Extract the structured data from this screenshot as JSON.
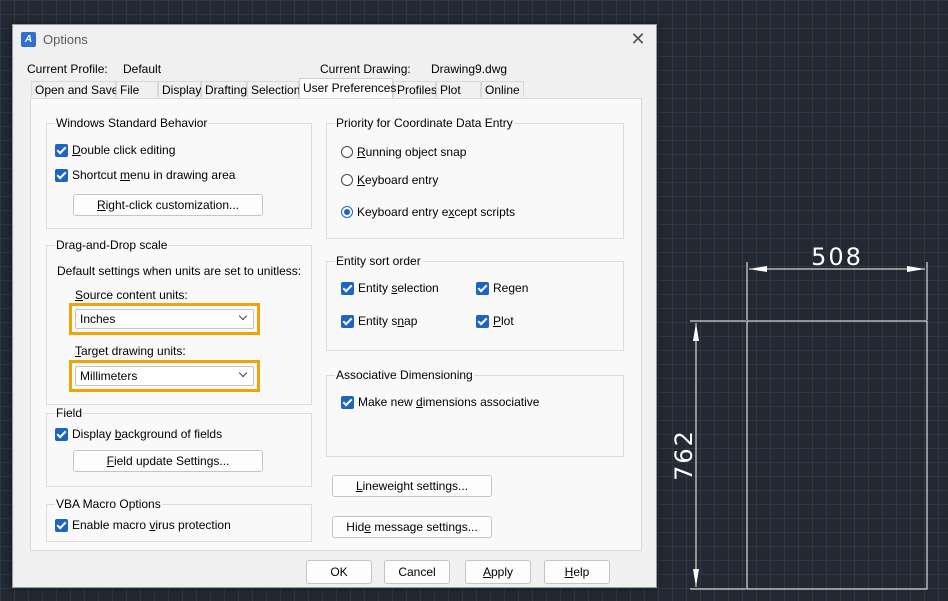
{
  "window": {
    "title": "Options"
  },
  "info": {
    "current_profile_label": "Current Profile:",
    "current_profile_value": "Default",
    "current_drawing_label": "Current Drawing:",
    "current_drawing_value": "Drawing9.dwg"
  },
  "tabs": [
    {
      "label": "Open and Save"
    },
    {
      "label": "File"
    },
    {
      "label": "Display"
    },
    {
      "label": "Drafting"
    },
    {
      "label": "Selection"
    },
    {
      "label": "User Preferences"
    },
    {
      "label": "Profiles"
    },
    {
      "label": "Plot"
    },
    {
      "label": "Online"
    }
  ],
  "windows_behavior": {
    "title": "Windows Standard Behavior",
    "double_click": {
      "pre": "",
      "key": "D",
      "post": "ouble click editing"
    },
    "shortcut_menu": {
      "pre": "Shortcut ",
      "key": "m",
      "post": "enu in drawing area"
    },
    "right_click_button": {
      "pre": "",
      "key": "R",
      "post": "ight-click customization..."
    }
  },
  "drag_drop": {
    "title": "Drag-and-Drop scale",
    "description": "Default settings when units are set to unitless:",
    "source_label": {
      "pre": "",
      "key": "S",
      "post": "ource content units:"
    },
    "source_value": "Inches",
    "target_label": {
      "pre": "",
      "key": "T",
      "post": "arget drawing units:"
    },
    "target_value": "Millimeters"
  },
  "field": {
    "title": "Field",
    "display_background": {
      "pre": "Display ",
      "key": "b",
      "post": "ackground of fields"
    },
    "update_button": {
      "pre": "",
      "key": "F",
      "post": "ield update Settings..."
    }
  },
  "vba": {
    "title": "VBA Macro Options",
    "enable_protection": {
      "pre": "Enable macro ",
      "key": "v",
      "post": "irus protection"
    }
  },
  "priority": {
    "title": "Priority for Coordinate Data Entry",
    "running_snap": {
      "pre": "",
      "key": "R",
      "post": "unning object snap"
    },
    "keyboard_entry": {
      "pre": "",
      "key": "K",
      "post": "eyboard entry"
    },
    "keyboard_except": {
      "pre": "Keyboard entry e",
      "key": "x",
      "post": "cept scripts"
    }
  },
  "sort_order": {
    "title": "Entity sort order",
    "entity_selection": {
      "pre": "Entity ",
      "key": "s",
      "post": "election"
    },
    "regen": {
      "pre": "Re",
      "key": "g",
      "post": "en"
    },
    "entity_snap": {
      "pre": "Entity s",
      "key": "n",
      "post": "ap"
    },
    "plot": {
      "pre": "",
      "key": "P",
      "post": "lot"
    }
  },
  "assoc_dim": {
    "title": "Associative Dimensioning",
    "make_new": {
      "pre": "Make new ",
      "key": "d",
      "post": "imensions associative"
    }
  },
  "lineweight_button": {
    "pre": "",
    "key": "L",
    "post": "ineweight settings..."
  },
  "hide_message_button": {
    "pre": "Hid",
    "key": "e",
    "post": " message settings..."
  },
  "footer": {
    "ok": "OK",
    "cancel": "Cancel",
    "apply": {
      "pre": "",
      "key": "A",
      "post": "pply"
    },
    "help": {
      "pre": "",
      "key": "H",
      "post": "elp"
    }
  },
  "cad": {
    "width_dim": "508",
    "height_dim": "762",
    "line_color": "#ffffff"
  }
}
